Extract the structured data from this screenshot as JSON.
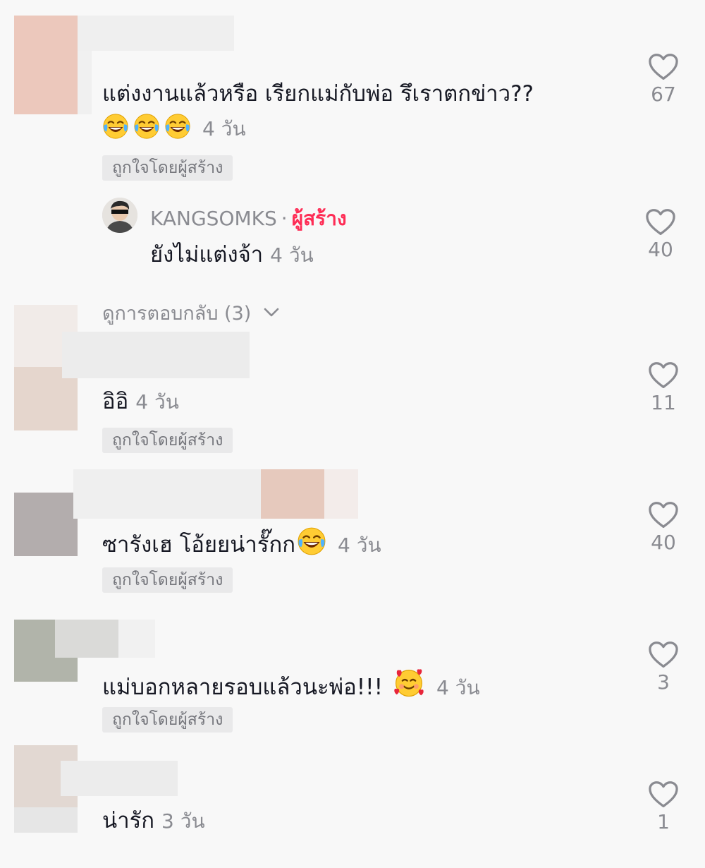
{
  "comments": [
    {
      "text": "แต่งงานแล้วหรือ เรียกแม่กับพ่อ รึเราตกข่าว??",
      "emoji_line_time": "4 วัน",
      "badge": "ถูกใจโดยผู้สร้าง",
      "likes": "67"
    },
    {
      "text": "อิอิ",
      "time": "4 วัน",
      "badge": "ถูกใจโดยผู้สร้าง",
      "likes": "11"
    },
    {
      "text": "ซารังเฮ โอ้ยยน่ารั๊กก",
      "time": "4 วัน",
      "badge": "ถูกใจโดยผู้สร้าง",
      "likes": "40"
    },
    {
      "text": "แม่บอกหลายรอบแล้วนะพ่อ!!!",
      "time": "4 วัน",
      "badge": "ถูกใจโดยผู้สร้าง",
      "likes": "3"
    },
    {
      "text": "น่ารัก",
      "time": "3 วัน",
      "likes": "1"
    }
  ],
  "reply": {
    "username": "KANGSOMKS",
    "separator": "·",
    "creator_label": "ผู้สร้าง",
    "text": "ยังไม่แต่งจ้า",
    "time": "4 วัน",
    "likes": "40"
  },
  "view_replies": "ดูการตอบกลับ (3)",
  "colors": {
    "creator_accent": "#fe2c55",
    "muted_text": "#8a8b91",
    "badge_bg": "#e9e9ea"
  },
  "icons": {
    "like": "heart-outline-icon",
    "laugh": "face-with-tears-of-joy-emoji",
    "love": "smiling-face-with-hearts-emoji",
    "expand": "chevron-down-icon"
  }
}
